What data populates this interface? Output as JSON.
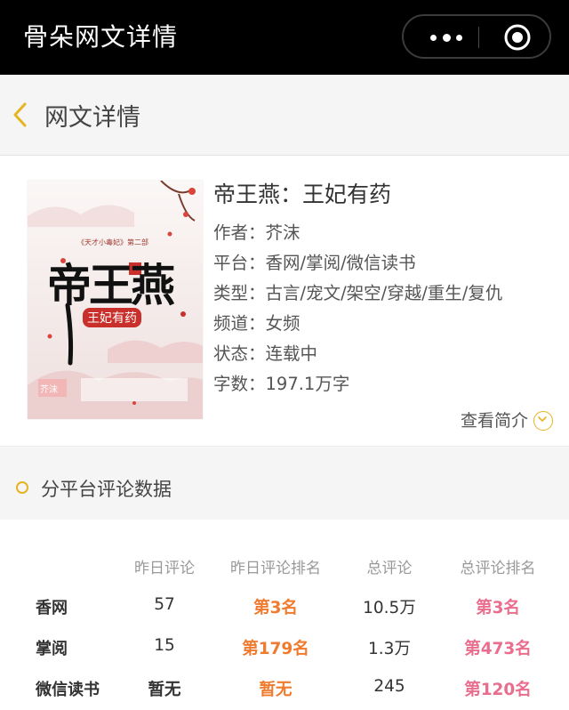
{
  "topbar": {
    "title": "骨朵网文详情",
    "more_icon": "more-dots-icon",
    "target_icon": "target-icon"
  },
  "header": {
    "title": "网文详情",
    "back_icon": "chevron-left-icon"
  },
  "book": {
    "title": "帝王燕：王妃有药",
    "author_label": "作者：",
    "author": "芥沫",
    "platform_label": "平台：",
    "platform": "香网/掌阅/微信读书",
    "genre_label": "类型：",
    "genre": "古言/宠文/架空/穿越/重生/复仇",
    "channel_label": "频道：",
    "channel": "女频",
    "status_label": "状态：",
    "status": "连载中",
    "words_label": "字数：",
    "words": "197.1万字",
    "intro_link": "查看简介",
    "cover": {
      "series": "《天才小毒妃》第二部",
      "big_title": "帝王燕",
      "subtitle": "王妃有药",
      "author_tag": "芥沫"
    }
  },
  "section": {
    "title": "分平台评论数据"
  },
  "table": {
    "headers": [
      "昨日评论",
      "昨日评论排名",
      "总评论",
      "总评论排名"
    ],
    "rows": [
      {
        "platform": "香网",
        "yesterday": "57",
        "yesterday_rank": "第3名",
        "total": "10.5万",
        "total_rank": "第3名"
      },
      {
        "platform": "掌阅",
        "yesterday": "15",
        "yesterday_rank": "第179名",
        "total": "1.3万",
        "total_rank": "第473名"
      },
      {
        "platform": "微信读书",
        "yesterday": "暂无",
        "yesterday_rank": "暂无",
        "total": "245",
        "total_rank": "第120名"
      }
    ]
  },
  "colors": {
    "accent": "#e6b422",
    "rank_orange": "#f07a2e",
    "rank_pink": "#ea6d8e"
  }
}
